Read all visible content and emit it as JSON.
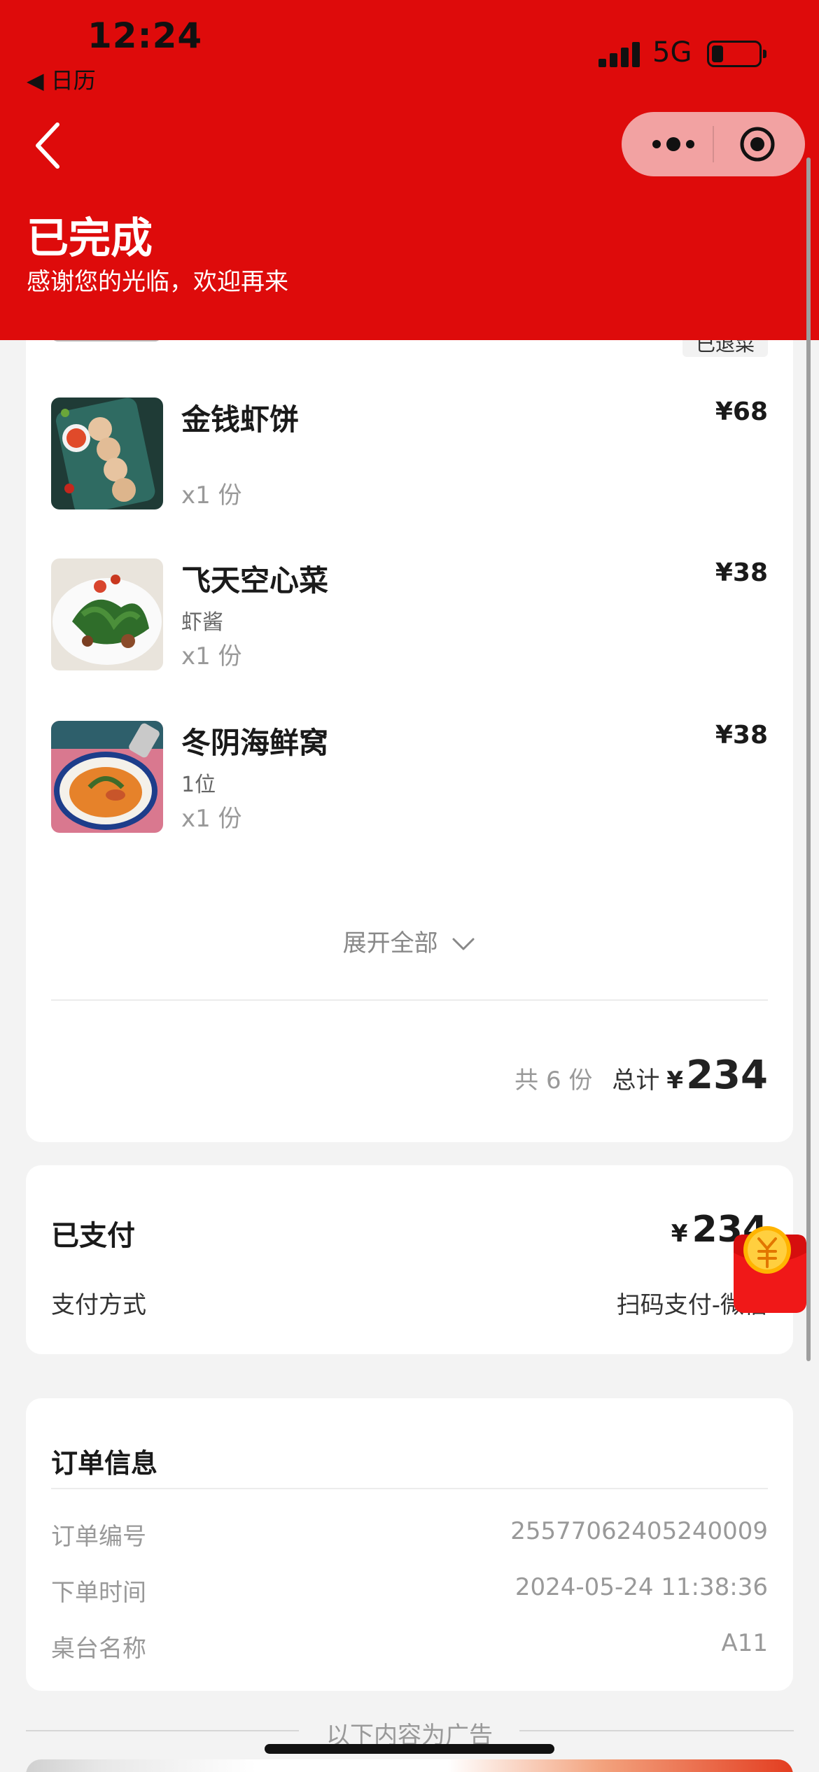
{
  "status_bar": {
    "time": "12:24",
    "back_app": "◀ 日历",
    "network": "5G"
  },
  "header": {
    "title": "已完成",
    "subtitle": "感谢您的光临，欢迎再来",
    "background": "#de0b0b"
  },
  "order_items": {
    "partial_tag": "已退菜",
    "items": [
      {
        "name": "金钱虾饼",
        "spec": "",
        "qty": "x1 份",
        "price": "¥68"
      },
      {
        "name": "飞天空心菜",
        "spec": "虾酱",
        "qty": "x1 份",
        "price": "¥38"
      },
      {
        "name": "冬阴海鲜窝",
        "spec": "1位",
        "qty": "x1 份",
        "price": "¥38"
      }
    ],
    "expand_label": "展开全部",
    "count_label": "共 6 份",
    "total_label": "总计",
    "currency": "¥",
    "total_amount": "234"
  },
  "payment": {
    "paid_label": "已支付",
    "currency": "¥",
    "paid_amount": "234",
    "method_label": "支付方式",
    "method_value": "扫码支付-微信"
  },
  "order_info": {
    "title": "订单信息",
    "rows": [
      {
        "label": "订单编号",
        "value": "25577062405240009"
      },
      {
        "label": "下单时间",
        "value": "2024-05-24 11:38:36"
      },
      {
        "label": "桌台名称",
        "value": "A11"
      }
    ]
  },
  "ad": {
    "label": "以下内容为广告"
  },
  "icons": {
    "back": "chevron-left-icon",
    "more": "more-dots-icon",
    "close": "target-circle-icon",
    "expand": "chevron-down-icon",
    "redpacket": "red-envelope-icon"
  }
}
